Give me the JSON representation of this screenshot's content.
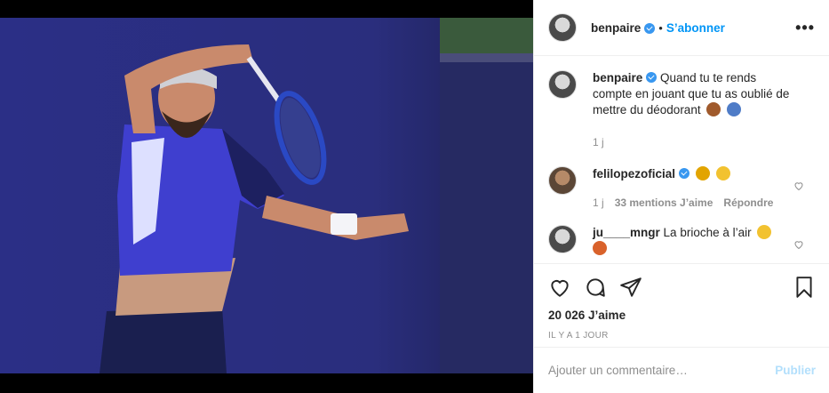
{
  "post": {
    "username": "benpaire",
    "follow_label": "S’abonner",
    "more_label": "•••",
    "dot": "•"
  },
  "caption": {
    "username": "benpaire",
    "text": "Quand tu te rends compte en jouant que tu as oublié de mettre du déodorant",
    "age": "1 j"
  },
  "comments": [
    {
      "username": "felilopezoficial",
      "text": "",
      "age": "1 j",
      "likes": "33 mentions J’aime",
      "reply": "Répondre"
    },
    {
      "username": "ju____mngr",
      "text": "La brioche à l’air"
    }
  ],
  "stats": {
    "likes": "20 026 J’aime",
    "time": "Il y a 1 jour"
  },
  "composer": {
    "placeholder": "Ajouter un commentaire…",
    "post_label": "Publier"
  },
  "colors": {
    "accent": "#0095f6",
    "verified": "#3897f0",
    "muted": "#8e8e8e"
  },
  "icons": [
    "like-icon",
    "comment-icon",
    "share-icon",
    "save-icon",
    "verified-icon",
    "more-icon"
  ]
}
